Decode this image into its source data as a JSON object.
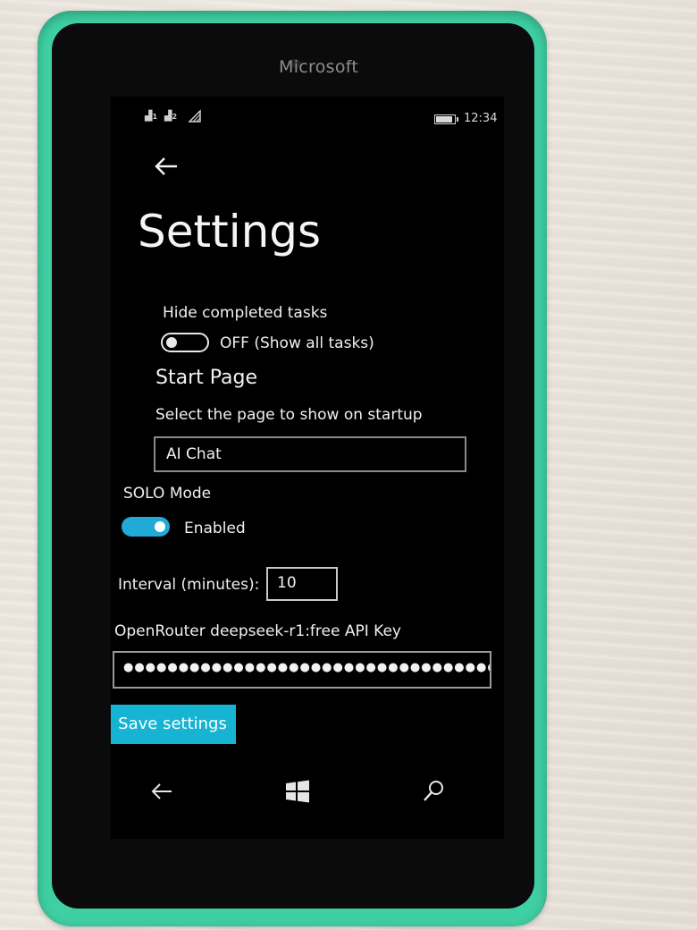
{
  "device": {
    "brand": "Microsoft"
  },
  "status_bar": {
    "signal_1": "1",
    "signal_2": "2",
    "time": "12:34"
  },
  "page": {
    "title": "Settings"
  },
  "hide_completed": {
    "label": "Hide completed tasks",
    "state_text": "OFF (Show all tasks)",
    "on": false
  },
  "start_page": {
    "heading": "Start Page",
    "description": "Select the page to show on startup",
    "selected": "AI Chat"
  },
  "solo_mode": {
    "label": "SOLO Mode",
    "state_text": "Enabled",
    "on": true
  },
  "interval": {
    "label": "Interval (minutes):",
    "value": "10"
  },
  "api_key": {
    "label": "OpenRouter deepseek-r1:free API Key",
    "masked_value": "●●●●●●●●●●●●●●●●●●●●●●●●●●●●●●●●●●●●●"
  },
  "actions": {
    "save_label": "Save settings"
  },
  "nav_bar": {
    "back_icon": "back-arrow-icon",
    "home_icon": "windows-logo-icon",
    "search_icon": "search-icon"
  },
  "colors": {
    "accent": "#16b3d3",
    "toggle_on": "#21a9d8",
    "case": "#3fcfa2"
  }
}
